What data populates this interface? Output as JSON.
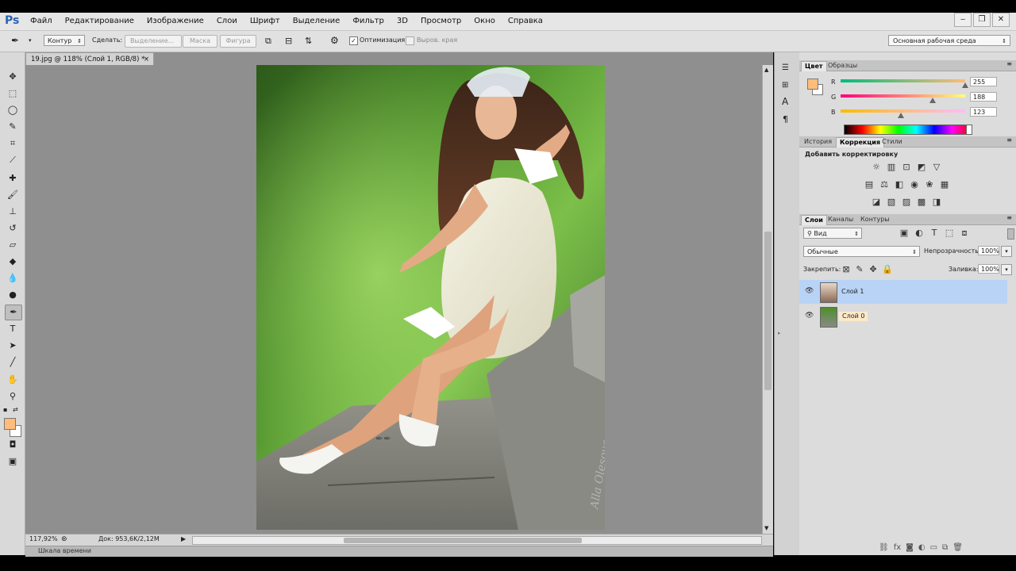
{
  "app": {
    "logo": "Ps"
  },
  "menu": [
    "Файл",
    "Редактирование",
    "Изображение",
    "Слои",
    "Шрифт",
    "Выделение",
    "Фильтр",
    "3D",
    "Просмотр",
    "Окно",
    "Справка"
  ],
  "window_controls": {
    "minimize": "‒",
    "restore": "❐",
    "close": "✕"
  },
  "options_bar": {
    "mode_value": "Контур",
    "make_label": "Сделать:",
    "selection_button": "Выделение...",
    "mask_button": "Маска",
    "shape_button": "Фигура",
    "optimization_label": "Оптимизация",
    "align_edges_label": "Выров. края",
    "workspace_value": "Основная рабочая среда"
  },
  "document": {
    "tab_title": "19.jpg @ 118% (Слой 1, RGB/8) *",
    "tab_close": "×",
    "zoom": "117,92%",
    "doc_info": "Док: 953,6K/2,12M",
    "timeline_label": "Шкала времени",
    "signature_text": "Alla Olesova"
  },
  "color_panel": {
    "tabs": [
      "Цвет",
      "Образцы"
    ],
    "channels": [
      {
        "label": "R",
        "value": "255",
        "level": 1.0
      },
      {
        "label": "G",
        "value": "188",
        "level": 0.737
      },
      {
        "label": "B",
        "value": "123",
        "level": 0.482
      }
    ],
    "foreground_color": "#ffbc7b"
  },
  "adjustments_panel": {
    "tabs": [
      "История",
      "Коррекция",
      "Стили"
    ],
    "title": "Добавить корректировку"
  },
  "layers_panel": {
    "tabs": [
      "Слои",
      "Каналы",
      "Контуры"
    ],
    "filter_value": "Вид",
    "blend_mode": "Обычные",
    "opacity_label": "Непрозрачность:",
    "opacity_value": "100%",
    "lock_label": "Закрепить:",
    "fill_label": "Заливка:",
    "fill_value": "100%",
    "layers": [
      {
        "name": "Слой 1",
        "selected": true
      },
      {
        "name": "Слой 0",
        "selected": false
      }
    ]
  },
  "colors": {
    "selection_blue": "#b8d3f5",
    "layer0_name_bg": "#fde9c8",
    "accent_orange": "#ffbc7b"
  }
}
